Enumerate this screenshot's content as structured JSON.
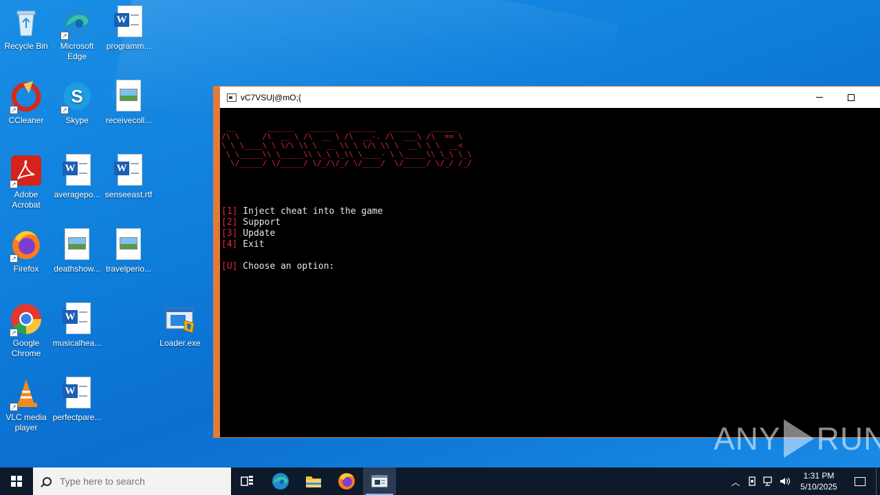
{
  "desktop": {
    "icons": [
      {
        "id": "recycle-bin",
        "label": "Recycle Bin"
      },
      {
        "id": "microsoft-edge",
        "label": "Microsoft Edge"
      },
      {
        "id": "programm",
        "label": "programm..."
      },
      {
        "id": "ccleaner",
        "label": "CCleaner"
      },
      {
        "id": "skype",
        "label": "Skype"
      },
      {
        "id": "receivecoll",
        "label": "receivecoll..."
      },
      {
        "id": "adobe-acrobat",
        "label": "Adobe Acrobat"
      },
      {
        "id": "averagepo",
        "label": "averagepo..."
      },
      {
        "id": "senseeast",
        "label": "senseeast.rtf"
      },
      {
        "id": "firefox",
        "label": "Firefox"
      },
      {
        "id": "deathshow",
        "label": "deathshow..."
      },
      {
        "id": "travelperio",
        "label": "travelperio..."
      },
      {
        "id": "google-chrome",
        "label": "Google Chrome"
      },
      {
        "id": "musicalhea",
        "label": "musicalhea..."
      },
      {
        "id": "loader-exe",
        "label": "Loader.exe"
      },
      {
        "id": "vlc",
        "label": "VLC media player"
      },
      {
        "id": "perfectpare",
        "label": "perfectpare..."
      }
    ]
  },
  "console": {
    "title": "vC7VSU|@mO;{",
    "banner": [
      " __       ______   ______   ______   ______   ______",
      "/\\ \\     /\\  __ \\ /\\  __ \\ /\\  __-. /\\  ___\\ /\\  == \\",
      "\\ \\ \\____\\ \\ \\/\\ \\\\ \\  __ \\\\ \\ \\/\\ \\\\ \\  __\\ \\ \\  __<",
      " \\ \\_____\\\\ \\_____\\\\ \\_\\ \\_\\\\ \\____- \\ \\_____\\\\ \\_\\ \\_\\",
      "  \\/_____/ \\/_____/ \\/_/\\/_/ \\/____/  \\/_____/ \\/_/ /_/"
    ],
    "menu": [
      {
        "key": "[1]",
        "text": " Inject cheat into the game"
      },
      {
        "key": "[2]",
        "text": " Support"
      },
      {
        "key": "[3]",
        "text": " Update"
      },
      {
        "key": "[4]",
        "text": " Exit"
      }
    ],
    "prompt": {
      "key": "[U]",
      "text": " Choose an option:"
    }
  },
  "watermark": {
    "left": "ANY",
    "right": "RUN"
  },
  "taskbar": {
    "search_placeholder": "Type here to search",
    "apps": [
      "task-view",
      "edge",
      "file-explorer",
      "firefox",
      "console"
    ],
    "clock": {
      "time": "1:31 PM",
      "date": "5/10/2025"
    }
  },
  "colors": {
    "accent_red": "#e0283c",
    "window_border": "#e07b39",
    "taskbar": "#0d1a2b"
  }
}
